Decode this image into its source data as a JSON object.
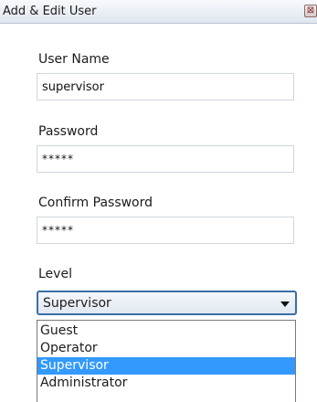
{
  "window": {
    "title": "Add & Edit User",
    "close_symbol": "⊠"
  },
  "form": {
    "username_label": "User Name",
    "username_value": "supervisor",
    "password_label": "Password",
    "password_value": "*****",
    "confirm_label": "Confirm Password",
    "confirm_value": "*****",
    "level_label": "Level",
    "level_selected": "Supervisor",
    "level_options": [
      "Guest",
      "Operator",
      "Supervisor",
      "Administrator"
    ]
  },
  "colors": {
    "selection": "#3399ff",
    "select_border": "#3a6ea8"
  }
}
